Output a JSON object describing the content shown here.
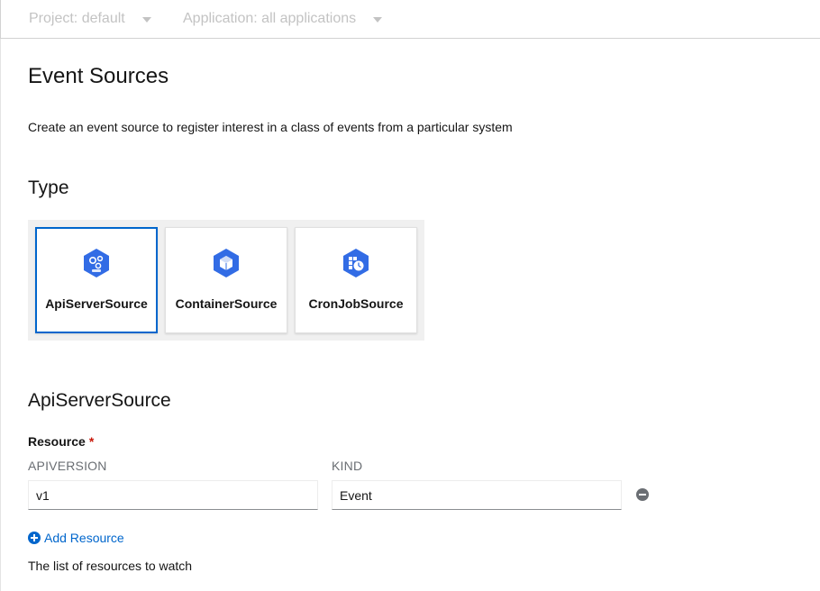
{
  "context_bar": {
    "project_label": "Project: default",
    "application_label": "Application: all applications"
  },
  "page": {
    "title": "Event Sources",
    "description": "Create an event source to register interest in a class of events from a particular system"
  },
  "type_section": {
    "heading": "Type",
    "tiles": [
      {
        "label": "ApiServerSource",
        "icon": "api-server-source-icon",
        "selected": true
      },
      {
        "label": "ContainerSource",
        "icon": "container-source-icon",
        "selected": false
      },
      {
        "label": "CronJobSource",
        "icon": "cron-job-source-icon",
        "selected": false
      }
    ]
  },
  "form": {
    "heading": "ApiServerSource",
    "resource_label": "Resource",
    "required_marker": "*",
    "columns": {
      "apiversion": "APIVERSION",
      "kind": "KIND"
    },
    "row": {
      "apiversion_value": "v1",
      "kind_value": "Event"
    },
    "add_resource_label": "Add Resource",
    "helper_text": "The list of resources to watch"
  },
  "colors": {
    "accent": "#0066cc",
    "icon_blue": "#326ce5",
    "required": "#c9190b"
  }
}
